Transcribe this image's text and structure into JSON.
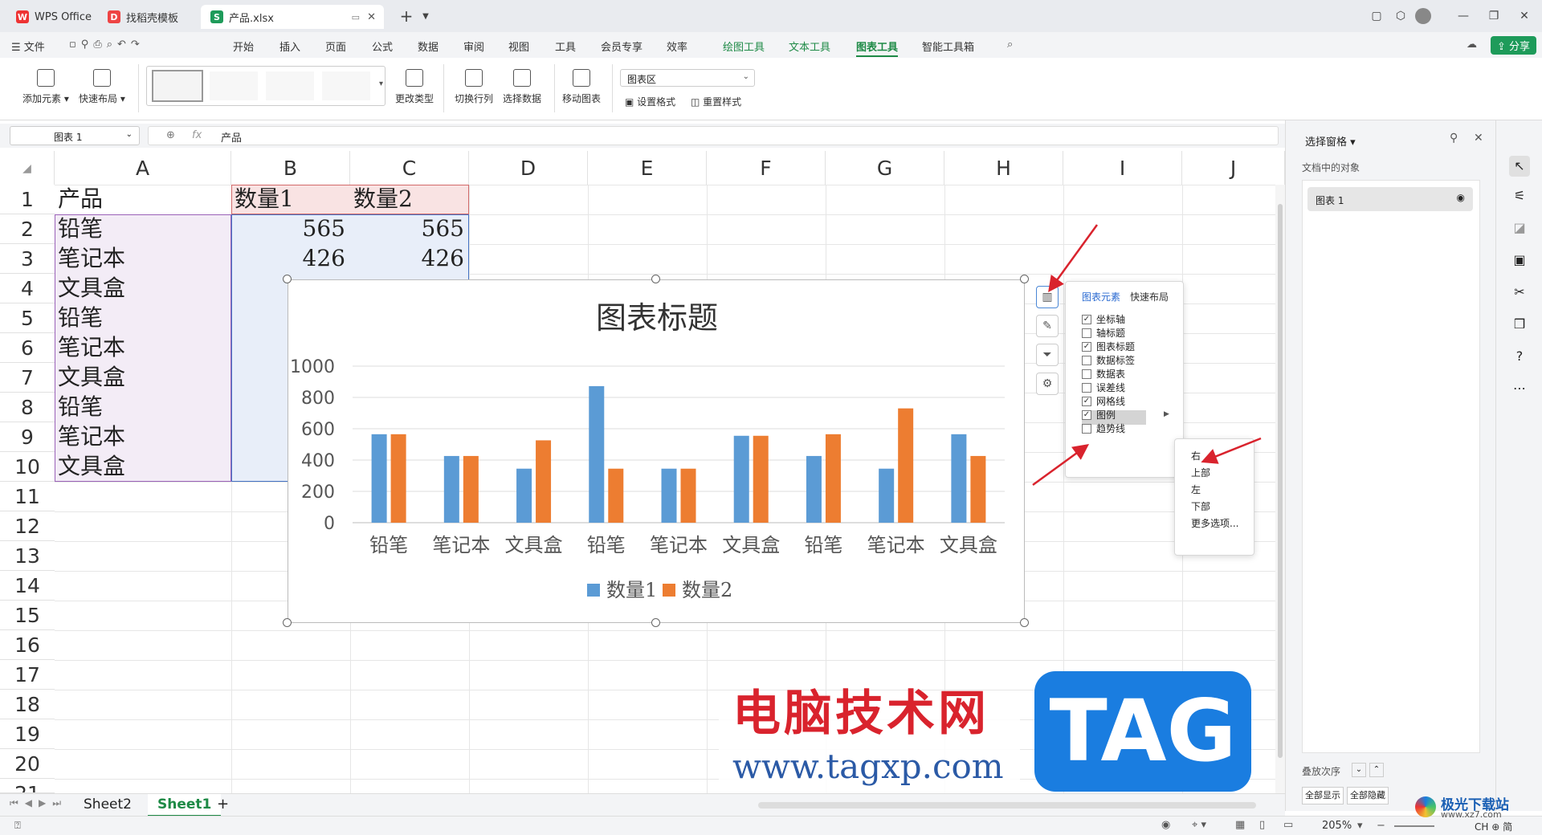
{
  "tabs": [
    {
      "label": "WPS Office",
      "logo": "W"
    },
    {
      "label": "找稻壳模板",
      "logo": "D"
    },
    {
      "label": "产品.xlsx",
      "logo": "S"
    }
  ],
  "menu": {
    "file": "文件",
    "items": [
      "开始",
      "插入",
      "页面",
      "公式",
      "数据",
      "审阅",
      "视图",
      "工具",
      "会员专享",
      "效率",
      "绘图工具",
      "文本工具",
      "图表工具",
      "智能工具箱"
    ],
    "share": "分享"
  },
  "ribbon": {
    "add_element": "添加元素",
    "quick_layout": "快速布局",
    "change_type": "更改类型",
    "switch_row_col": "切换行列",
    "select_data": "选择数据",
    "move_chart": "移动图表",
    "chart_area_select": "图表区",
    "set_format": "设置格式",
    "reset_style": "重置样式"
  },
  "formula_bar": {
    "name_box": "图表 1",
    "fx": "fx",
    "content": "产品"
  },
  "columns": [
    "A",
    "B",
    "C",
    "D",
    "E",
    "F",
    "G",
    "H",
    "I",
    "J"
  ],
  "rows": [
    "1",
    "2",
    "3",
    "4",
    "5",
    "6",
    "7",
    "8",
    "9",
    "10",
    "11",
    "12",
    "13",
    "14",
    "15",
    "16",
    "17",
    "18",
    "19",
    "20",
    "21"
  ],
  "cells": {
    "a1": "产品",
    "b1": "数量1",
    "c1": "数量2",
    "a2": "铅笔",
    "b2": "565",
    "c2": "565",
    "a3": "笔记本",
    "b3": "426",
    "c3": "426",
    "a4": "文具盒",
    "a5": "铅笔",
    "a6": "笔记本",
    "a7": "文具盒",
    "a8": "铅笔",
    "a9": "笔记本",
    "a10": "文具盒"
  },
  "chart_data": {
    "type": "bar",
    "title": "图表标题",
    "categories": [
      "铅笔",
      "笔记本",
      "文具盒",
      "铅笔",
      "笔记本",
      "文具盒",
      "铅笔",
      "笔记本",
      "文具盒"
    ],
    "series": [
      {
        "name": "数量1",
        "values": [
          565,
          426,
          345,
          872,
          345,
          555,
          426,
          345,
          565
        ],
        "color": "#5b9bd5"
      },
      {
        "name": "数量2",
        "values": [
          565,
          426,
          526,
          345,
          345,
          555,
          565,
          730,
          426
        ],
        "color": "#ed7d31"
      }
    ],
    "ylim": [
      0,
      1000
    ],
    "yticks": [
      "1000",
      "800",
      "600",
      "400",
      "200",
      "0"
    ],
    "grid": true,
    "legend": "bottom"
  },
  "chart_elements_popup": {
    "tab_elements": "图表元素",
    "tab_layout": "快速布局",
    "items": [
      {
        "label": "坐标轴",
        "checked": true
      },
      {
        "label": "轴标题",
        "checked": false
      },
      {
        "label": "图表标题",
        "checked": true
      },
      {
        "label": "数据标签",
        "checked": false
      },
      {
        "label": "数据表",
        "checked": false
      },
      {
        "label": "误差线",
        "checked": false
      },
      {
        "label": "网格线",
        "checked": true
      },
      {
        "label": "图例",
        "checked": true
      },
      {
        "label": "趋势线",
        "checked": false
      }
    ]
  },
  "legend_submenu": [
    "右",
    "上部",
    "左",
    "下部",
    "更多选项..."
  ],
  "selection_pane": {
    "title": "选择窗格",
    "objects_label": "文档中的对象",
    "object": "图表 1",
    "order_label": "叠放次序",
    "show_all": "全部显示",
    "hide_all": "全部隐藏"
  },
  "sheets": [
    "Sheet2",
    "Sheet1"
  ],
  "status": {
    "zoom": "205%",
    "ime": "CH ⊕ 简"
  },
  "watermark": {
    "title": "电脑技术网",
    "url": "www.tagxp.com",
    "logo": "TAG",
    "site": "极光下载站",
    "site_url": "www.xz7.com"
  }
}
